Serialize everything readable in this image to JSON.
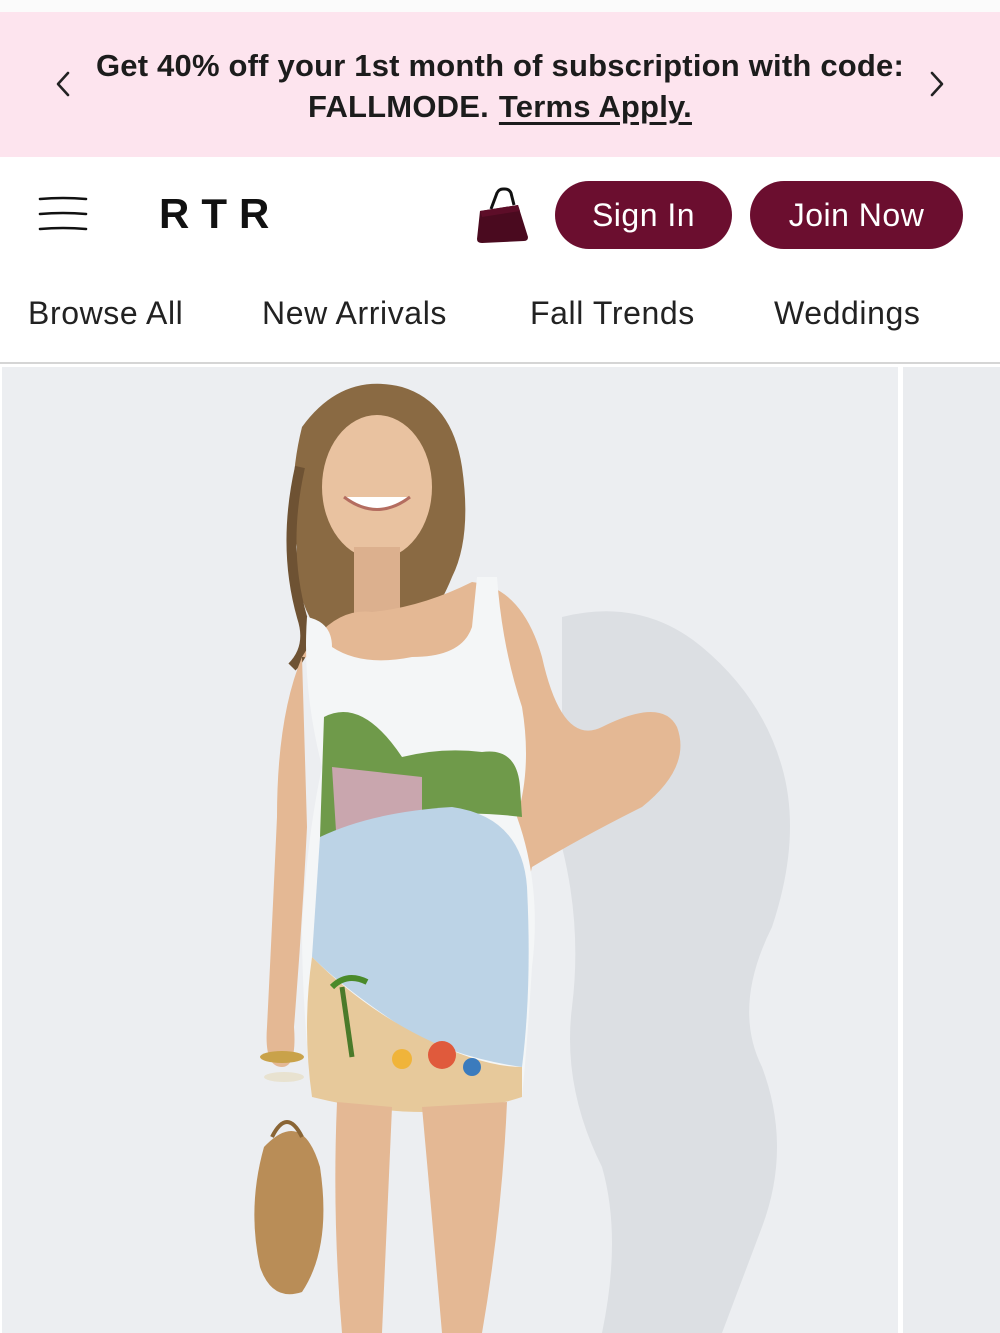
{
  "promo": {
    "line1": "Get 40% off your 1st month of subscription with code:",
    "line2": "FALLMODE.",
    "terms_link": "Terms Apply."
  },
  "header": {
    "logo": "RTR",
    "sign_in": "Sign In",
    "join_now": "Join Now"
  },
  "nav": {
    "items": [
      "Browse All",
      "New Arrivals",
      "Fall Trends",
      "Weddings"
    ]
  },
  "colors": {
    "promo_bg": "#fde4ee",
    "brand": "#6b0e2f",
    "photo_bg": "#eceef1"
  },
  "icons": [
    "chevron-left-icon",
    "chevron-right-icon",
    "menu-icon",
    "shopping-bag-icon"
  ]
}
